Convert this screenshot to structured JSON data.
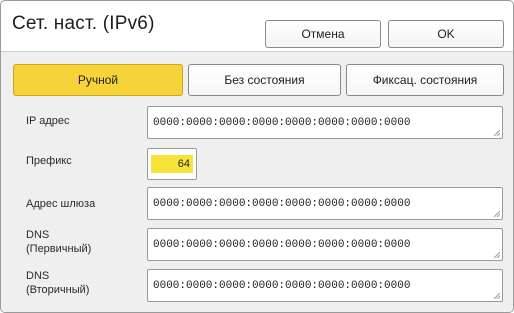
{
  "header": {
    "title": "Сет. наст. (IPv6)",
    "cancel_label": "Отмена",
    "ok_label": "OK"
  },
  "tabs": [
    {
      "label": "Ручной",
      "active": true
    },
    {
      "label": "Без состояния",
      "active": false
    },
    {
      "label": "Фиксац. состояния",
      "active": false
    }
  ],
  "fields": {
    "ip": {
      "label": "IP адрес",
      "value": "0000:0000:0000:0000:0000:0000:0000:0000"
    },
    "prefix": {
      "label": "Префикс",
      "value": "64"
    },
    "gateway": {
      "label": "Адрес шлюза",
      "value": "0000:0000:0000:0000:0000:0000:0000:0000"
    },
    "dns_primary": {
      "label_line1": "DNS",
      "label_line2": "(Первичный)",
      "value": "0000:0000:0000:0000:0000:0000:0000:0000"
    },
    "dns_secondary": {
      "label_line1": "DNS",
      "label_line2": "(Вторичный)",
      "value": "0000:0000:0000:0000:0000:0000:0000:0000"
    }
  },
  "colors": {
    "accent": "#f7d33a",
    "prefix_highlight": "#f7e43b",
    "panel_bg": "#efefef"
  }
}
